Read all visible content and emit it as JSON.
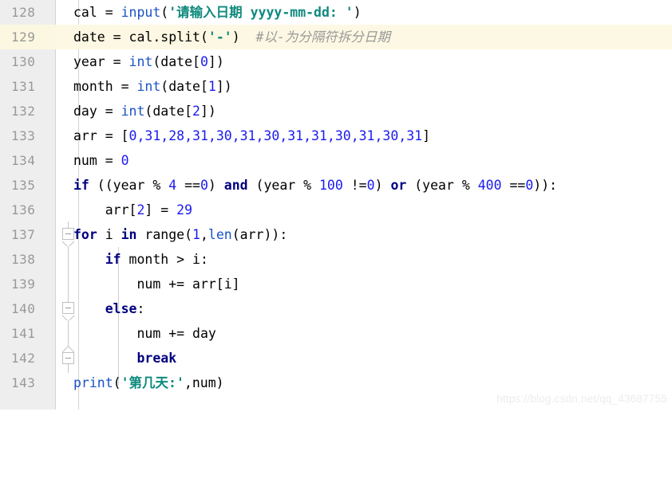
{
  "editor": {
    "first_line_number": 128,
    "highlighted_line": 129,
    "gutter_color": "#eeeeee",
    "highlight_color": "#fdf8e3",
    "keyword_color": "#000080",
    "builtin_color": "#1a52c4",
    "number_color": "#1a1af0",
    "string_color": "#108a7e",
    "comment_color": "#999999"
  },
  "watermark": {
    "text": "https://blog.csdn.net/qq_43687755"
  },
  "lines": [
    {
      "n": "128",
      "text": "cal = input('请输入日期 yyyy-mm-dd: ')"
    },
    {
      "n": "129",
      "text": "date = cal.split('-')  #以-为分隔符拆分日期"
    },
    {
      "n": "130",
      "text": "year = int(date[0])"
    },
    {
      "n": "131",
      "text": "month = int(date[1])"
    },
    {
      "n": "132",
      "text": "day = int(date[2])"
    },
    {
      "n": "133",
      "text": "arr = [0,31,28,31,30,31,30,31,31,30,31,30,31]"
    },
    {
      "n": "134",
      "text": "num = 0"
    },
    {
      "n": "135",
      "text": "if ((year % 4 ==0) and (year % 100 !=0) or (year % 400 ==0)):"
    },
    {
      "n": "136",
      "text": "    arr[2] = 29"
    },
    {
      "n": "137",
      "text": "for i in range(1,len(arr)):"
    },
    {
      "n": "138",
      "text": "    if month > i:"
    },
    {
      "n": "139",
      "text": "        num += arr[i]"
    },
    {
      "n": "140",
      "text": "    else:"
    },
    {
      "n": "141",
      "text": "        num += day"
    },
    {
      "n": "142",
      "text": "        break"
    },
    {
      "n": "143",
      "text": "print('第几天:',num)"
    }
  ],
  "line_numbers": {
    "l128": "128",
    "l129": "129",
    "l130": "130",
    "l131": "131",
    "l132": "132",
    "l133": "133",
    "l134": "134",
    "l135": "135",
    "l136": "136",
    "l137": "137",
    "l138": "138",
    "l139": "139",
    "l140": "140",
    "l141": "141",
    "l142": "142",
    "l143": "143"
  },
  "tokens": {
    "l128": {
      "a": "cal = ",
      "b": "input",
      "c": "(",
      "d": "'请输入日期 yyyy-mm-dd: '",
      "e": ")"
    },
    "l129": {
      "a": "date = cal.split(",
      "b": "'-'",
      "c": ")  ",
      "d": "#以-为分隔符拆分日期"
    },
    "l130": {
      "a": "year = ",
      "b": "int",
      "c": "(date[",
      "d": "0",
      "e": "])"
    },
    "l131": {
      "a": "month = ",
      "b": "int",
      "c": "(date[",
      "d": "1",
      "e": "])"
    },
    "l132": {
      "a": "day = ",
      "b": "int",
      "c": "(date[",
      "d": "2",
      "e": "])"
    },
    "l133": {
      "a": "arr = [",
      "b": "0,31,28,31,30,31,30,31,31,30,31,30,31",
      "c": "]"
    },
    "l134": {
      "a": "num = ",
      "b": "0"
    },
    "l135": {
      "a": "if",
      "b": " ((year % ",
      "c": "4",
      "d": " ==",
      "e": "0",
      "f": ") ",
      "g": "and",
      "h": " (year % ",
      "i": "100",
      "j": " !=",
      "k": "0",
      "l": ") ",
      "m": "or",
      "n": " (year % ",
      "o": "400",
      "p": " ==",
      "q": "0",
      "r": ")):"
    },
    "l136": {
      "a": "    arr[",
      "b": "2",
      "c": "] = ",
      "d": "29"
    },
    "l137": {
      "a": "for",
      "b": " i ",
      "c": "in",
      "d": " range(",
      "e": "1",
      "f": ",",
      "g": "len",
      "h": "(arr)):"
    },
    "l138": {
      "a": "    ",
      "b": "if",
      "c": " month > i:"
    },
    "l139": {
      "a": "        num += arr[i]"
    },
    "l140": {
      "a": "    ",
      "b": "else",
      "c": ":"
    },
    "l141": {
      "a": "        num += day"
    },
    "l142": {
      "a": "        ",
      "b": "break"
    },
    "l143": {
      "a": "print",
      "b": "(",
      "c": "'第几天:'",
      "d": ",num)"
    }
  }
}
